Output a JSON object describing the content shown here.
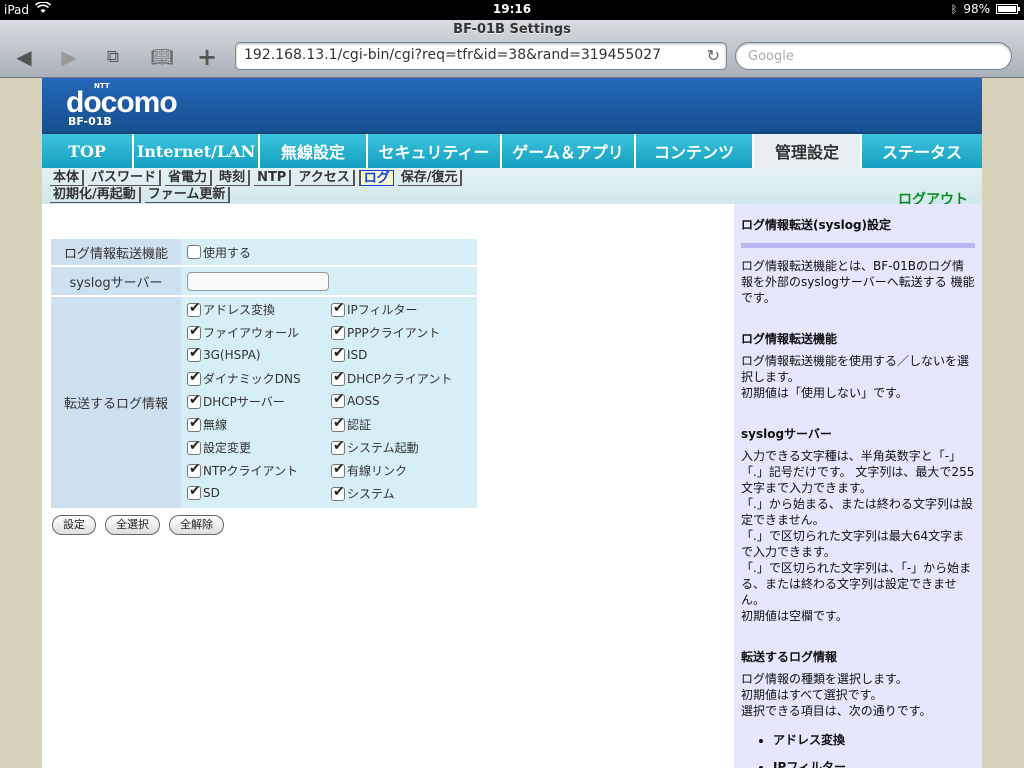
{
  "status": {
    "device": "iPad",
    "time": "19:16",
    "battery": "98%",
    "battery_level": 0.98
  },
  "browser": {
    "title": "BF-01B Settings",
    "url": "192.168.13.1/cgi-bin/cgi?req=tfr&id=38&rand=319455027",
    "search_placeholder": "Google"
  },
  "header": {
    "brand": "docomo",
    "brand_small": "NTT",
    "model": "BF-01B"
  },
  "main_tabs": [
    "TOP",
    "Internet/LAN",
    "無線設定",
    "セキュリティー",
    "ゲーム＆アプリ",
    "コンテンツ",
    "管理設定",
    "ステータス"
  ],
  "sub_tabs_row1": [
    "本体",
    "パスワード",
    "省電力",
    "時刻",
    "NTP",
    "アクセス",
    "ログ",
    "保存/復元"
  ],
  "sub_tabs_row2": [
    "初期化/再起動",
    "ファーム更新"
  ],
  "logout": "ログアウト",
  "form": {
    "transfer_label": "ログ情報転送機能",
    "transfer_option": "使用する",
    "syslog_label": "syslogサーバー",
    "syslog_value": "",
    "loginfo_label": "転送するログ情報",
    "log_items": [
      [
        "アドレス変換",
        "IPフィルター"
      ],
      [
        "ファイアウォール",
        "PPPクライアント"
      ],
      [
        "3G(HSPA)",
        "ISD"
      ],
      [
        "ダイナミックDNS",
        "DHCPクライアント"
      ],
      [
        "DHCPサーバー",
        "AOSS"
      ],
      [
        "無線",
        "認証"
      ],
      [
        "設定変更",
        "システム起動"
      ],
      [
        "NTPクライアント",
        "有線リンク"
      ],
      [
        "SD",
        "システム"
      ]
    ]
  },
  "buttons": {
    "set": "設定",
    "select_all": "全選択",
    "deselect_all": "全解除"
  },
  "help": {
    "title": "ログ情報転送(syslog)設定",
    "intro": "ログ情報転送機能とは、BF-01Bのログ情報を外部のsyslogサーバーへ転送する 機能です。",
    "s1_title": "ログ情報転送機能",
    "s1_text": "ログ情報転送機能を使用する／しないを選択します。",
    "s1_default": "初期値は「使用しない」です。",
    "s2_title": "syslogサーバー",
    "s2_text": "入力できる文字種は、半角英数字と「-」「.」記号だけです。 文字列は、最大で255文字まで入力できます。",
    "s2_t2": "「.」から始まる、または終わる文字列は設定できません。",
    "s2_t3": "「.」で区切られた文字列は最大64文字まで入力できます。",
    "s2_t4": "「.」で区切られた文字列は、「-」から始まる、または終わる文字列は設定できません。",
    "s2_default": "初期値は空欄です。",
    "s3_title": "転送するログ情報",
    "s3_text": "ログ情報の種類を選択します。",
    "s3_default": "初期値はすべて選択です。",
    "s3_t2": "選択できる項目は、次の通りです。",
    "s3_items": [
      "アドレス変換",
      "IPフィルター"
    ]
  }
}
